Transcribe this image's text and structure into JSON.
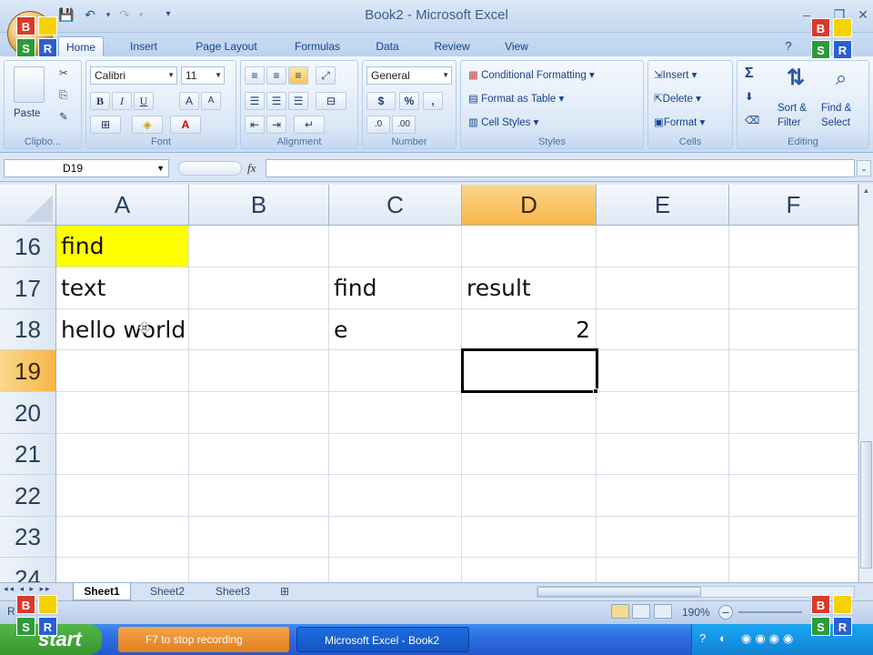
{
  "window": {
    "title": "Book2 - Microsoft Excel"
  },
  "quick_access": [
    "save-icon",
    "undo-icon",
    "redo-icon",
    "customize-icon"
  ],
  "tabs": [
    {
      "label": "Home",
      "active": true
    },
    {
      "label": "Insert"
    },
    {
      "label": "Page Layout"
    },
    {
      "label": "Formulas"
    },
    {
      "label": "Data"
    },
    {
      "label": "Review"
    },
    {
      "label": "View"
    }
  ],
  "ribbon": {
    "clipboard": {
      "paste_label": "Paste",
      "group_label": "Clipbo..."
    },
    "font": {
      "font_name": "Calibri",
      "font_size": "11",
      "bold": "B",
      "italic": "I",
      "underline": "U",
      "grow": "A",
      "shrink": "A",
      "group_label": "Font"
    },
    "alignment": {
      "group_label": "Alignment"
    },
    "number": {
      "format": "General",
      "currency": "$",
      "percent": "%",
      "comma": ",",
      "group_label": "Number"
    },
    "styles": {
      "conditional_formatting": "Conditional Formatting",
      "format_as_table": "Format as Table",
      "cell_styles": "Cell Styles",
      "group_label": "Styles"
    },
    "cells": {
      "insert": "Insert",
      "delete": "Delete",
      "format": "Format",
      "group_label": "Cells"
    },
    "editing": {
      "sigma": "Σ",
      "sort_filter_1": "Sort &",
      "sort_filter_2": "Filter",
      "find_select_1": "Find &",
      "find_select_2": "Select",
      "group_label": "Editing"
    }
  },
  "formula_bar": {
    "name_box": "D19",
    "fx": "fx",
    "formula": ""
  },
  "sheet": {
    "columns": [
      "A",
      "B",
      "C",
      "D",
      "E",
      "F"
    ],
    "selected_column": "D",
    "rows": [
      "16",
      "17",
      "18",
      "19",
      "20",
      "21",
      "22",
      "23",
      "24"
    ],
    "selected_row": "19",
    "cells": {
      "A16": "find",
      "A17": "text",
      "C17": "find",
      "D17": "result",
      "A18": "hello world",
      "C18": "e",
      "D18": "2"
    },
    "highlight_color": "#ffff00"
  },
  "sheet_tabs": [
    {
      "label": "Sheet1",
      "active": true
    },
    {
      "label": "Sheet2"
    },
    {
      "label": "Sheet3"
    }
  ],
  "status": {
    "zoom": "190%"
  },
  "taskbar": {
    "start": "start",
    "tasks": [
      {
        "label": "F7 to stop recording"
      },
      {
        "label": "Microsoft Excel - Book2"
      }
    ]
  },
  "logo": {
    "b": "B",
    "s": "S",
    "r": "R"
  }
}
